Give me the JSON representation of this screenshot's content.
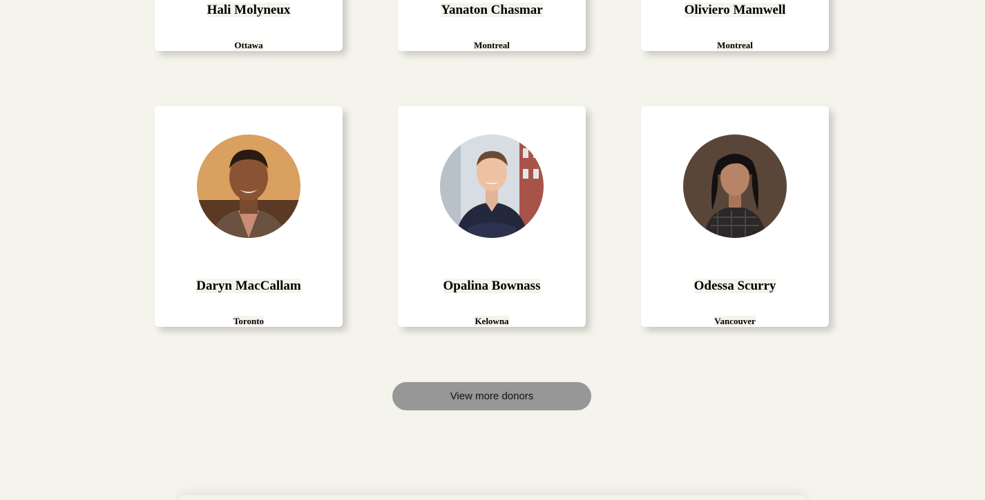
{
  "donors_top": [
    {
      "name": "Hali Molyneux",
      "city": "Ottawa"
    },
    {
      "name": "Yanaton Chasmar",
      "city": "Montreal"
    },
    {
      "name": "Oliviero Mamwell",
      "city": "Montreal"
    }
  ],
  "donors_bottom": [
    {
      "name": "Daryn MacCallam",
      "city": "Toronto",
      "avatar_icon": "donor-photo-icon"
    },
    {
      "name": "Opalina Bownass",
      "city": "Kelowna",
      "avatar_icon": "donor-photo-icon"
    },
    {
      "name": "Odessa Scurry",
      "city": "Vancouver",
      "avatar_icon": "donor-photo-icon"
    }
  ],
  "actions": {
    "view_more_label": "View more donors"
  },
  "colors": {
    "background": "#f5f4ec",
    "card": "#ffffff",
    "button": "#979797"
  }
}
